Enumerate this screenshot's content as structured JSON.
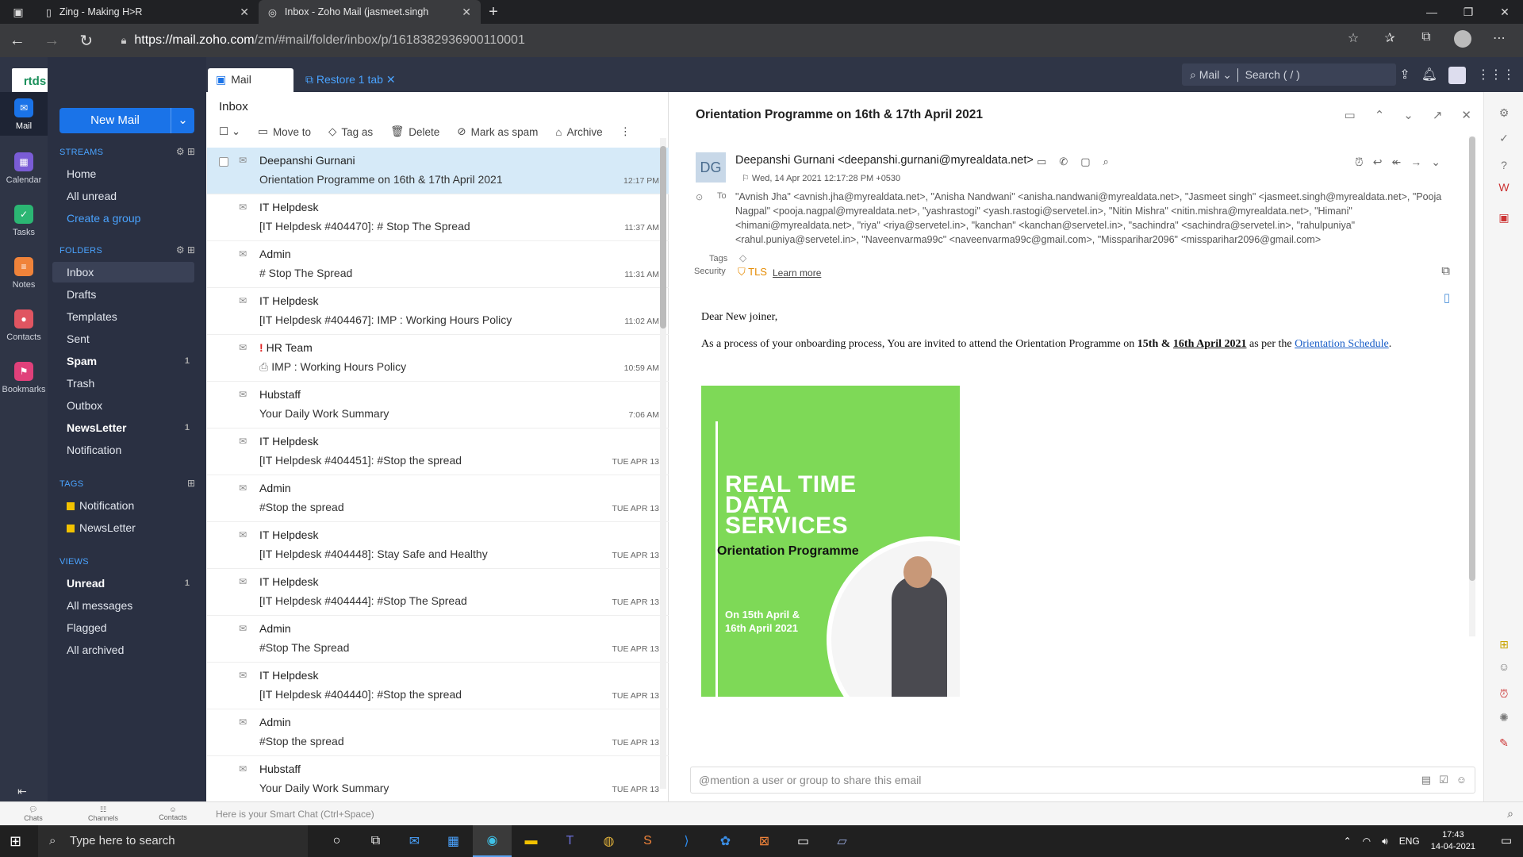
{
  "browser": {
    "tabs": [
      {
        "title": "Zing - Making H>R"
      },
      {
        "title": "Inbox - Zoho Mail (jasmeet.singh"
      }
    ],
    "url_host": "https://mail.zoho.com",
    "url_path": "/zm/#mail/folder/inbox/p/1618382936900110001"
  },
  "rail": {
    "logo": "rtds",
    "items": [
      {
        "label": "Mail",
        "color": "#1a73e8"
      },
      {
        "label": "Calendar",
        "color": "#7a5cd6"
      },
      {
        "label": "Tasks",
        "color": "#2bb673"
      },
      {
        "label": "Notes",
        "color": "#f0833a"
      },
      {
        "label": "Contacts",
        "color": "#e05561"
      },
      {
        "label": "Bookmarks",
        "color": "#e0407a"
      }
    ]
  },
  "sidebar": {
    "new_mail": "New Mail",
    "streams_label": "STREAMS",
    "streams": [
      "Home",
      "All unread"
    ],
    "create_group": "Create a group",
    "folders_label": "FOLDERS",
    "folders": [
      {
        "label": "Inbox",
        "count": ""
      },
      {
        "label": "Drafts",
        "count": ""
      },
      {
        "label": "Templates",
        "count": ""
      },
      {
        "label": "Sent",
        "count": ""
      },
      {
        "label": "Spam",
        "count": "1"
      },
      {
        "label": "Trash",
        "count": ""
      },
      {
        "label": "Outbox",
        "count": ""
      },
      {
        "label": "NewsLetter",
        "count": "1"
      },
      {
        "label": "Notification",
        "count": ""
      }
    ],
    "tags_label": "TAGS",
    "tags": [
      "Notification",
      "NewsLetter"
    ],
    "views_label": "VIEWS",
    "views": [
      {
        "label": "Unread",
        "count": "1"
      },
      {
        "label": "All messages",
        "count": ""
      },
      {
        "label": "Flagged",
        "count": ""
      },
      {
        "label": "All archived",
        "count": ""
      }
    ]
  },
  "apptop": {
    "tab_label": "Mail",
    "restore": "Restore 1 tab",
    "search_scope": "Mail",
    "search_placeholder": "Search ( / )"
  },
  "list": {
    "title": "Inbox",
    "toolbar": [
      "Move to",
      "Tag as",
      "Delete",
      "Mark as spam",
      "Archive"
    ],
    "rows": [
      {
        "from": "Deepanshi Gurnani",
        "subject": "Orientation Programme on 16th & 17th April 2021",
        "time": "12:17 PM"
      },
      {
        "from": "IT Helpdesk",
        "subject": "[IT Helpdesk #404470]: # Stop The Spread",
        "time": "11:37 AM"
      },
      {
        "from": "Admin",
        "subject": "# Stop The Spread",
        "time": "11:31 AM"
      },
      {
        "from": "IT Helpdesk",
        "subject": "[IT Helpdesk #404467]: IMP : Working Hours Policy",
        "time": "11:02 AM"
      },
      {
        "from": "HR Team",
        "subject": "IMP : Working Hours Policy",
        "time": "10:59 AM",
        "important": "!"
      },
      {
        "from": "Hubstaff",
        "subject": "Your Daily Work Summary",
        "time": "7:06 AM"
      },
      {
        "from": "IT Helpdesk",
        "subject": "[IT Helpdesk #404451]: #Stop the spread",
        "time": "TUE APR 13"
      },
      {
        "from": "Admin",
        "subject": "#Stop the spread",
        "time": "TUE APR 13"
      },
      {
        "from": "IT Helpdesk",
        "subject": "[IT Helpdesk #404448]: Stay Safe and Healthy",
        "time": "TUE APR 13"
      },
      {
        "from": "IT Helpdesk",
        "subject": "[IT Helpdesk #404444]: #Stop The Spread",
        "time": "TUE APR 13"
      },
      {
        "from": "Admin",
        "subject": "#Stop The Spread",
        "time": "TUE APR 13"
      },
      {
        "from": "IT Helpdesk",
        "subject": "[IT Helpdesk #404440]: #Stop the spread",
        "time": "TUE APR 13"
      },
      {
        "from": "Admin",
        "subject": "#Stop the spread",
        "time": "TUE APR 13"
      },
      {
        "from": "Hubstaff",
        "subject": "Your Daily Work Summary",
        "time": "TUE APR 13"
      }
    ]
  },
  "reader": {
    "subject": "Orientation Programme on 16th & 17th April 2021",
    "avatar_initials": "DG",
    "sender": "Deepanshi Gurnani <deepanshi.gurnani@myrealdata.net>",
    "date": "Wed, 14 Apr 2021 12:17:28 PM +0530",
    "to_label": "To",
    "recipients": "\"Avnish Jha\" <avnish.jha@myrealdata.net>, \"Anisha Nandwani\" <anisha.nandwani@myrealdata.net>, \"Jasmeet singh\" <jasmeet.singh@myrealdata.net>, \"Pooja Nagpal\" <pooja.nagpal@myrealdata.net>, \"yashrastogi\" <yash.rastogi@servetel.in>, \"Nitin Mishra\" <nitin.mishra@myrealdata.net>, \"Himani\" <himani@myrealdata.net>, \"riya\" <riya@servetel.in>, \"kanchan\" <kanchan@servetel.in>, \"sachindra\" <sachindra@servetel.in>, \"rahulpuniya\" <rahul.puniya@servetel.in>, \"Naveenvarma99c\" <naveenvarma99c@gmail.com>, \"Missparihar2096\" <missparihar2096@gmail.com>",
    "tags_label": "Tags",
    "security_label": "Security",
    "tls": "TLS",
    "learn_more": "Learn more",
    "greeting": "Dear New joiner,",
    "body_pre": "As a process of your onboarding process, You are invited to attend the Orientation Programme on ",
    "body_bold1": "15th & ",
    "body_bold2": "16th April 2021",
    "body_mid": " as per the ",
    "body_link": "Orientation Schedule",
    "body_end": ".",
    "poster": {
      "headline_1": "REAL TIME",
      "headline_2": "DATA",
      "headline_3": "SERVICES",
      "subtitle": "Orientation Programme",
      "date_1": "On 15th April &",
      "date_2": "16th April 2021"
    },
    "mention_placeholder": "@mention a user or group to share this email"
  },
  "chatbar": {
    "chats": "Chats",
    "channels": "Channels",
    "contacts": "Contacts",
    "smart_chat": "Here is your Smart Chat (Ctrl+Space)"
  },
  "taskbar": {
    "search": "Type here to search",
    "lang": "ENG",
    "time": "17:43",
    "date": "14-04-2021"
  }
}
